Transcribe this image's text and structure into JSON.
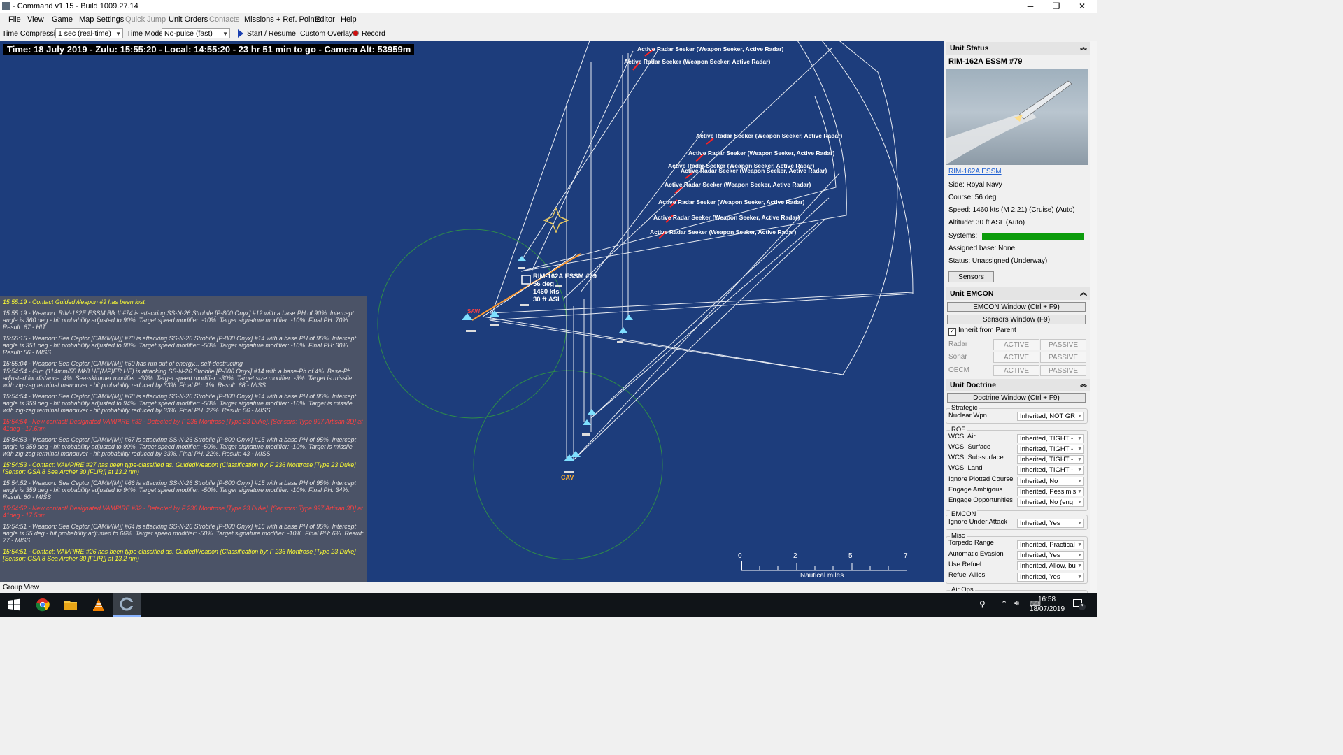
{
  "window": {
    "title": "- Command v1.15 - Build 1009.27.14",
    "minimize": "─",
    "maximize": "❐",
    "close": "✕"
  },
  "menu": [
    "File",
    "View",
    "Game",
    "Map Settings",
    "Quick Jump",
    "Unit Orders",
    "Contacts",
    "Missions + Ref. Points",
    "Editor",
    "Help"
  ],
  "toolbar": {
    "time_compression_label": "Time Compression:",
    "time_compression_value": "1 sec (real-time)",
    "time_mode_label": "Time Mode:",
    "time_mode_value": "No-pulse (fast)",
    "start_resume": "Start / Resume",
    "custom_overlay": "Custom Overlay",
    "record": "Record"
  },
  "map": {
    "time_banner": "Time: 18 July 2019 - Zulu: 15:55:20 - Local: 14:55:20 - 23 hr 51 min to go -  Camera Alt: 53959m",
    "seekers": [
      "Active Radar Seeker (Weapon Seeker, Active Radar)",
      "Active Radar Seeker (Weapon Seeker, Active Radar)",
      "Active Radar Seeker (Weapon Seeker, Active Radar)",
      "Active Radar Seeker (Weapon Seeker, Active Radar)",
      "Active Radar Seeker (Weapon Seeker, Active Radar)",
      "Active Radar Seeker (Weapon Seeker, Active Radar)",
      "Active Radar Seeker (Weapon Seeker, Active Radar)",
      "Active Radar Seeker (Weapon Seeker, Active Radar)",
      "Active Radar Seeker (Weapon Seeker, Active Radar)",
      "Active Radar Seeker (Weapon Seeker, Active Radar)"
    ],
    "unit_label": [
      "RIM-162A ESSM #79",
      "56 deg",
      "1460 kts",
      "30 ft ASL"
    ],
    "group_labels": {
      "saw": "SAW",
      "cav": "CAV"
    },
    "scale": {
      "ticks": [
        "0",
        "2",
        "5",
        "7"
      ],
      "unit": "Nautical miles"
    },
    "colors": {
      "sea": "#1d3d7c",
      "range_ring": "#2e8a4a",
      "track": "#ffffff",
      "hostile": "#ff2020"
    }
  },
  "log": [
    {
      "cls": "y",
      "text": "15:55:19 - Contact GuidedWeapon #9 has been lost."
    },
    {
      "cls": "w",
      "text": "15:55:19 - Weapon: RIM-162E ESSM Blk II #74 is attacking SS-N-26 Strobile [P-800 Onyx] #12 with a base PH of 90%. Intercept angle is 360 deg - hit probability adjusted to 90%. Target speed modifier: -10%. Target signature modifier: -10%. Final PH: 70%. Result: 67 - HIT"
    },
    {
      "cls": "w",
      "text": "15:55:15 - Weapon: Sea Ceptor [CAMM(M)] #70 is attacking SS-N-26 Strobile [P-800 Onyx] #14 with a base PH of 95%. Intercept angle is 351 deg - hit probability adjusted to 90%. Target speed modifier: -50%. Target signature modifier: -10%. Final PH: 30%. Result: 56 - MISS"
    },
    {
      "cls": "w",
      "text": "15:55:04 - Weapon: Sea Ceptor [CAMM(M)] #50 has run out of energy... self-destructing"
    },
    {
      "cls": "w",
      "text": "15:54:54 - Gun (114mm/55 Mk8 HE(MP)ER HE) is attacking SS-N-26 Strobile [P-800 Onyx] #14 with a base-Ph of 4%. Base-Ph adjusted for distance: 4%. Sea-skimmer modifier: -30%. Target speed modifier: -30%. Target size modifier: -3%. Target is missile with zig-zag terminal manouver - hit probability reduced by 33%. Final Ph: 1%. Result: 68 - MISS"
    },
    {
      "cls": "w",
      "text": "15:54:54 - Weapon: Sea Ceptor [CAMM(M)] #68 is attacking SS-N-26 Strobile [P-800 Onyx] #14 with a base PH of 95%. Intercept angle is 359 deg - hit probability adjusted to 94%. Target speed modifier: -50%. Target signature modifier: -10%. Target is missile with zig-zag terminal manouver - hit probability reduced by 33%. Final PH: 22%. Result: 56 - MISS"
    },
    {
      "cls": "r",
      "text": "15:54:54 - New contact! Designated VAMPIRE #33 - Detected by F 236 Montrose [Type 23 Duke]. [Sensors: Type 997 Artisan 3D] at 41deg - 17.6nm"
    },
    {
      "cls": "w",
      "text": "15:54:53 - Weapon: Sea Ceptor [CAMM(M)] #67 is attacking SS-N-26 Strobile [P-800 Onyx] #15 with a base PH of 95%. Intercept angle is 359 deg - hit probability adjusted to 90%. Target speed modifier: -50%. Target signature modifier: -10%. Target is missile with zig-zag terminal manouver - hit probability reduced by 33%. Final PH: 22%. Result: 43 - MISS"
    },
    {
      "cls": "y",
      "text": "15:54:53 - Contact: VAMPIRE #27 has been type-classified as: GuidedWeapon (Classification by: F 236 Montrose [Type 23 Duke] [Sensor: GSA 8 Sea Archer 30 [FLIR]] at 13.2 nm)"
    },
    {
      "cls": "w",
      "text": "15:54:52 - Weapon: Sea Ceptor [CAMM(M)] #66 is attacking SS-N-26 Strobile [P-800 Onyx] #15 with a base PH of 95%. Intercept angle is 359 deg - hit probability adjusted to 94%. Target speed modifier: -50%. Target signature modifier: -10%. Final PH: 34%. Result: 80 - MISS"
    },
    {
      "cls": "r",
      "text": "15:54:52 - New contact! Designated VAMPIRE #32 - Detected by F 236 Montrose [Type 23 Duke]. [Sensors: Type 997 Artisan 3D] at 41deg - 17.5nm"
    },
    {
      "cls": "w",
      "text": "15:54:51 - Weapon: Sea Ceptor [CAMM(M)] #64 is attacking SS-N-26 Strobile [P-800 Onyx] #15 with a base PH of 95%. Intercept angle is 55 deg - hit probability adjusted to 66%. Target speed modifier: -50%. Target signature modifier: -10%. Final PH: 6%. Result: 77 - MISS"
    },
    {
      "cls": "y",
      "text": "15:54:51 - Contact: VAMPIRE #26 has been type-classified as: GuidedWeapon (Classification by: F 236 Montrose [Type 23 Duke] [Sensor: GSA 8 Sea Archer 30 [FLIR]] at 13.2 nm)"
    }
  ],
  "panel": {
    "unit_status_title": "Unit Status",
    "unit_name": "RIM-162A ESSM #79",
    "unit_link": "RIM-162A ESSM",
    "side": "Side: Royal Navy",
    "course": "Course: 56 deg",
    "speed": "Speed: 1460 kts (M 2.21) (Cruise)    (Auto)",
    "altitude": "Altitude: 30 ft ASL    (Auto)",
    "systems_label": "Systems:",
    "systems_health": 1.0,
    "assigned_base": "Assigned base: None",
    "status": "Status: Unassigned (Underway)",
    "sensors_btn": "Sensors",
    "emcon_title": "Unit EMCON",
    "emcon_window": "EMCON Window (Ctrl + F9)",
    "sensors_window": "Sensors Window (F9)",
    "inherit": "Inherit from Parent",
    "emcon_rows": [
      {
        "label": "Radar",
        "active": "ACTIVE",
        "passive": "PASSIVE"
      },
      {
        "label": "Sonar",
        "active": "ACTIVE",
        "passive": "PASSIVE"
      },
      {
        "label": "OECM",
        "active": "ACTIVE",
        "passive": "PASSIVE"
      }
    ],
    "doctrine_title": "Unit Doctrine",
    "doctrine_window": "Doctrine Window (Ctrl + F9)",
    "strategic_label": "Strategic",
    "nuclear": {
      "label": "Nuclear Wpn",
      "value": "Inherited, NOT GR"
    },
    "roe_label": "ROE",
    "roe": [
      {
        "label": "WCS, Air",
        "value": "Inherited, TIGHT -"
      },
      {
        "label": "WCS, Surface",
        "value": "Inherited, TIGHT -"
      },
      {
        "label": "WCS, Sub-surface",
        "value": "Inherited, TIGHT -"
      },
      {
        "label": "WCS, Land",
        "value": "Inherited, TIGHT -"
      },
      {
        "label": "Ignore Plotted Course",
        "value": "Inherited, No"
      },
      {
        "label": "Engage Ambigous",
        "value": "Inherited, Pessimis"
      },
      {
        "label": "Engage Opportunities",
        "value": "Inherited, No (eng"
      }
    ],
    "emcon_group_label": "EMCON",
    "ignore_under_attack": {
      "label": "Ignore Under Attack",
      "value": "Inherited, Yes"
    },
    "misc_label": "Misc",
    "misc": [
      {
        "label": "Torpedo Range",
        "value": "Inherited, Practical"
      },
      {
        "label": "Automatic Evasion",
        "value": "Inherited, Yes"
      },
      {
        "label": "Use Refuel",
        "value": "Inherited, Allow, bu"
      },
      {
        "label": "Refuel Allies",
        "value": "Inherited, Yes"
      }
    ],
    "air_ops_label": "Air Ops"
  },
  "statusbar": {
    "text": "Group View"
  },
  "taskbar": {
    "time": "16:58",
    "date": "18/07/2019",
    "notifications": "3"
  }
}
